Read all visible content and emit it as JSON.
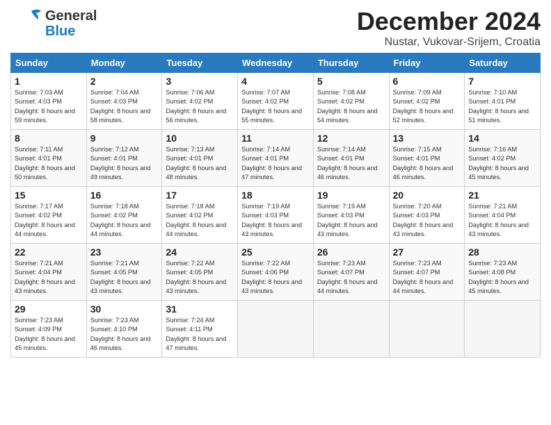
{
  "header": {
    "logo_general": "General",
    "logo_blue": "Blue",
    "month_title": "December 2024",
    "location": "Nustar, Vukovar-Srijem, Croatia"
  },
  "columns": [
    "Sunday",
    "Monday",
    "Tuesday",
    "Wednesday",
    "Thursday",
    "Friday",
    "Saturday"
  ],
  "weeks": [
    [
      {
        "day": "1",
        "sunrise": "Sunrise: 7:03 AM",
        "sunset": "Sunset: 4:03 PM",
        "daylight": "Daylight: 8 hours and 59 minutes."
      },
      {
        "day": "2",
        "sunrise": "Sunrise: 7:04 AM",
        "sunset": "Sunset: 4:03 PM",
        "daylight": "Daylight: 8 hours and 58 minutes."
      },
      {
        "day": "3",
        "sunrise": "Sunrise: 7:06 AM",
        "sunset": "Sunset: 4:02 PM",
        "daylight": "Daylight: 8 hours and 56 minutes."
      },
      {
        "day": "4",
        "sunrise": "Sunrise: 7:07 AM",
        "sunset": "Sunset: 4:02 PM",
        "daylight": "Daylight: 8 hours and 55 minutes."
      },
      {
        "day": "5",
        "sunrise": "Sunrise: 7:08 AM",
        "sunset": "Sunset: 4:02 PM",
        "daylight": "Daylight: 8 hours and 54 minutes."
      },
      {
        "day": "6",
        "sunrise": "Sunrise: 7:09 AM",
        "sunset": "Sunset: 4:02 PM",
        "daylight": "Daylight: 8 hours and 52 minutes."
      },
      {
        "day": "7",
        "sunrise": "Sunrise: 7:10 AM",
        "sunset": "Sunset: 4:01 PM",
        "daylight": "Daylight: 8 hours and 51 minutes."
      }
    ],
    [
      {
        "day": "8",
        "sunrise": "Sunrise: 7:11 AM",
        "sunset": "Sunset: 4:01 PM",
        "daylight": "Daylight: 8 hours and 50 minutes."
      },
      {
        "day": "9",
        "sunrise": "Sunrise: 7:12 AM",
        "sunset": "Sunset: 4:01 PM",
        "daylight": "Daylight: 8 hours and 49 minutes."
      },
      {
        "day": "10",
        "sunrise": "Sunrise: 7:13 AM",
        "sunset": "Sunset: 4:01 PM",
        "daylight": "Daylight: 8 hours and 48 minutes."
      },
      {
        "day": "11",
        "sunrise": "Sunrise: 7:14 AM",
        "sunset": "Sunset: 4:01 PM",
        "daylight": "Daylight: 8 hours and 47 minutes."
      },
      {
        "day": "12",
        "sunrise": "Sunrise: 7:14 AM",
        "sunset": "Sunset: 4:01 PM",
        "daylight": "Daylight: 8 hours and 46 minutes."
      },
      {
        "day": "13",
        "sunrise": "Sunrise: 7:15 AM",
        "sunset": "Sunset: 4:01 PM",
        "daylight": "Daylight: 8 hours and 46 minutes."
      },
      {
        "day": "14",
        "sunrise": "Sunrise: 7:16 AM",
        "sunset": "Sunset: 4:02 PM",
        "daylight": "Daylight: 8 hours and 45 minutes."
      }
    ],
    [
      {
        "day": "15",
        "sunrise": "Sunrise: 7:17 AM",
        "sunset": "Sunset: 4:02 PM",
        "daylight": "Daylight: 8 hours and 44 minutes."
      },
      {
        "day": "16",
        "sunrise": "Sunrise: 7:18 AM",
        "sunset": "Sunset: 4:02 PM",
        "daylight": "Daylight: 8 hours and 44 minutes."
      },
      {
        "day": "17",
        "sunrise": "Sunrise: 7:18 AM",
        "sunset": "Sunset: 4:02 PM",
        "daylight": "Daylight: 8 hours and 44 minutes."
      },
      {
        "day": "18",
        "sunrise": "Sunrise: 7:19 AM",
        "sunset": "Sunset: 4:03 PM",
        "daylight": "Daylight: 8 hours and 43 minutes."
      },
      {
        "day": "19",
        "sunrise": "Sunrise: 7:19 AM",
        "sunset": "Sunset: 4:03 PM",
        "daylight": "Daylight: 8 hours and 43 minutes."
      },
      {
        "day": "20",
        "sunrise": "Sunrise: 7:20 AM",
        "sunset": "Sunset: 4:03 PM",
        "daylight": "Daylight: 8 hours and 43 minutes."
      },
      {
        "day": "21",
        "sunrise": "Sunrise: 7:21 AM",
        "sunset": "Sunset: 4:04 PM",
        "daylight": "Daylight: 8 hours and 43 minutes."
      }
    ],
    [
      {
        "day": "22",
        "sunrise": "Sunrise: 7:21 AM",
        "sunset": "Sunset: 4:04 PM",
        "daylight": "Daylight: 8 hours and 43 minutes."
      },
      {
        "day": "23",
        "sunrise": "Sunrise: 7:21 AM",
        "sunset": "Sunset: 4:05 PM",
        "daylight": "Daylight: 8 hours and 43 minutes."
      },
      {
        "day": "24",
        "sunrise": "Sunrise: 7:22 AM",
        "sunset": "Sunset: 4:05 PM",
        "daylight": "Daylight: 8 hours and 43 minutes."
      },
      {
        "day": "25",
        "sunrise": "Sunrise: 7:22 AM",
        "sunset": "Sunset: 4:06 PM",
        "daylight": "Daylight: 8 hours and 43 minutes."
      },
      {
        "day": "26",
        "sunrise": "Sunrise: 7:23 AM",
        "sunset": "Sunset: 4:07 PM",
        "daylight": "Daylight: 8 hours and 44 minutes."
      },
      {
        "day": "27",
        "sunrise": "Sunrise: 7:23 AM",
        "sunset": "Sunset: 4:07 PM",
        "daylight": "Daylight: 8 hours and 44 minutes."
      },
      {
        "day": "28",
        "sunrise": "Sunrise: 7:23 AM",
        "sunset": "Sunset: 4:08 PM",
        "daylight": "Daylight: 8 hours and 45 minutes."
      }
    ],
    [
      {
        "day": "29",
        "sunrise": "Sunrise: 7:23 AM",
        "sunset": "Sunset: 4:09 PM",
        "daylight": "Daylight: 8 hours and 45 minutes."
      },
      {
        "day": "30",
        "sunrise": "Sunrise: 7:23 AM",
        "sunset": "Sunset: 4:10 PM",
        "daylight": "Daylight: 8 hours and 46 minutes."
      },
      {
        "day": "31",
        "sunrise": "Sunrise: 7:24 AM",
        "sunset": "Sunset: 4:11 PM",
        "daylight": "Daylight: 8 hours and 47 minutes."
      },
      null,
      null,
      null,
      null
    ]
  ]
}
